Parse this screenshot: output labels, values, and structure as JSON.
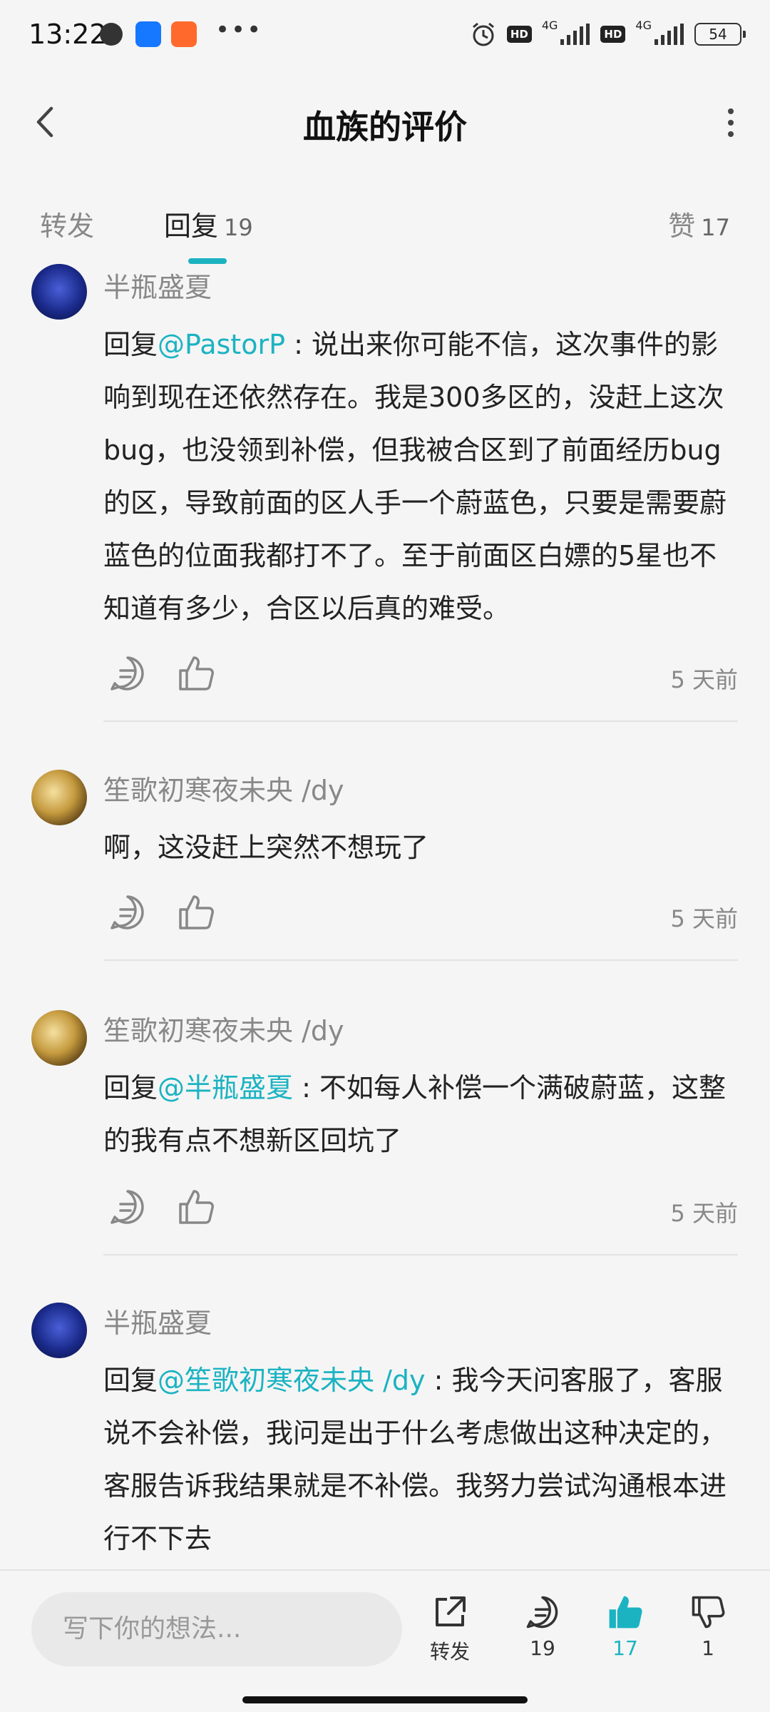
{
  "status": {
    "time": "13:22",
    "net1": "4G",
    "net2": "4G",
    "battery": "54"
  },
  "header": {
    "title": "血族的评价"
  },
  "tabs": [
    {
      "label": "转发",
      "count": ""
    },
    {
      "label": "回复",
      "count": "19"
    },
    {
      "label": "赞",
      "count": "17"
    }
  ],
  "comments": [
    {
      "user": "半瓶盛夏",
      "prefix": "回复",
      "mention": "@PastorP",
      "sep": " : ",
      "text": "说出来你可能不信，这次事件的影响到现在还依然存在。我是300多区的，没赶上这次bug，也没领到补偿，但我被合区到了前面经历bug的区，导致前面的区人手一个蔚蓝色，只要是需要蔚蓝色的位面我都打不了。至于前面区白嫖的5星也不知道有多少，合区以后真的难受。",
      "time": "5 天前"
    },
    {
      "user": "笙歌初寒夜未央 /dy",
      "prefix": "",
      "mention": "",
      "sep": "",
      "text": "啊，这没赶上突然不想玩了",
      "time": "5 天前"
    },
    {
      "user": "笙歌初寒夜未央 /dy",
      "prefix": "回复",
      "mention": "@半瓶盛夏",
      "sep": " : ",
      "text": "不如每人补偿一个满破蔚蓝，这整的我有点不想新区回坑了",
      "time": "5 天前"
    },
    {
      "user": "半瓶盛夏",
      "prefix": "回复",
      "mention": "@笙歌初寒夜未央 /dy",
      "sep": " : ",
      "text": "我今天问客服了，客服说不会补偿，我问是出于什么考虑做出这种决定的，客服告诉我结果就是不补偿。我努力尝试沟通根本进行不下去",
      "time": ""
    }
  ],
  "bottom": {
    "placeholder": "写下你的想法...",
    "repost_label": "转发",
    "reply_count": "19",
    "like_count": "17",
    "dislike_count": "1"
  },
  "colors": {
    "accent": "#1bb3c2",
    "text": "#222222",
    "muted": "#888888"
  }
}
